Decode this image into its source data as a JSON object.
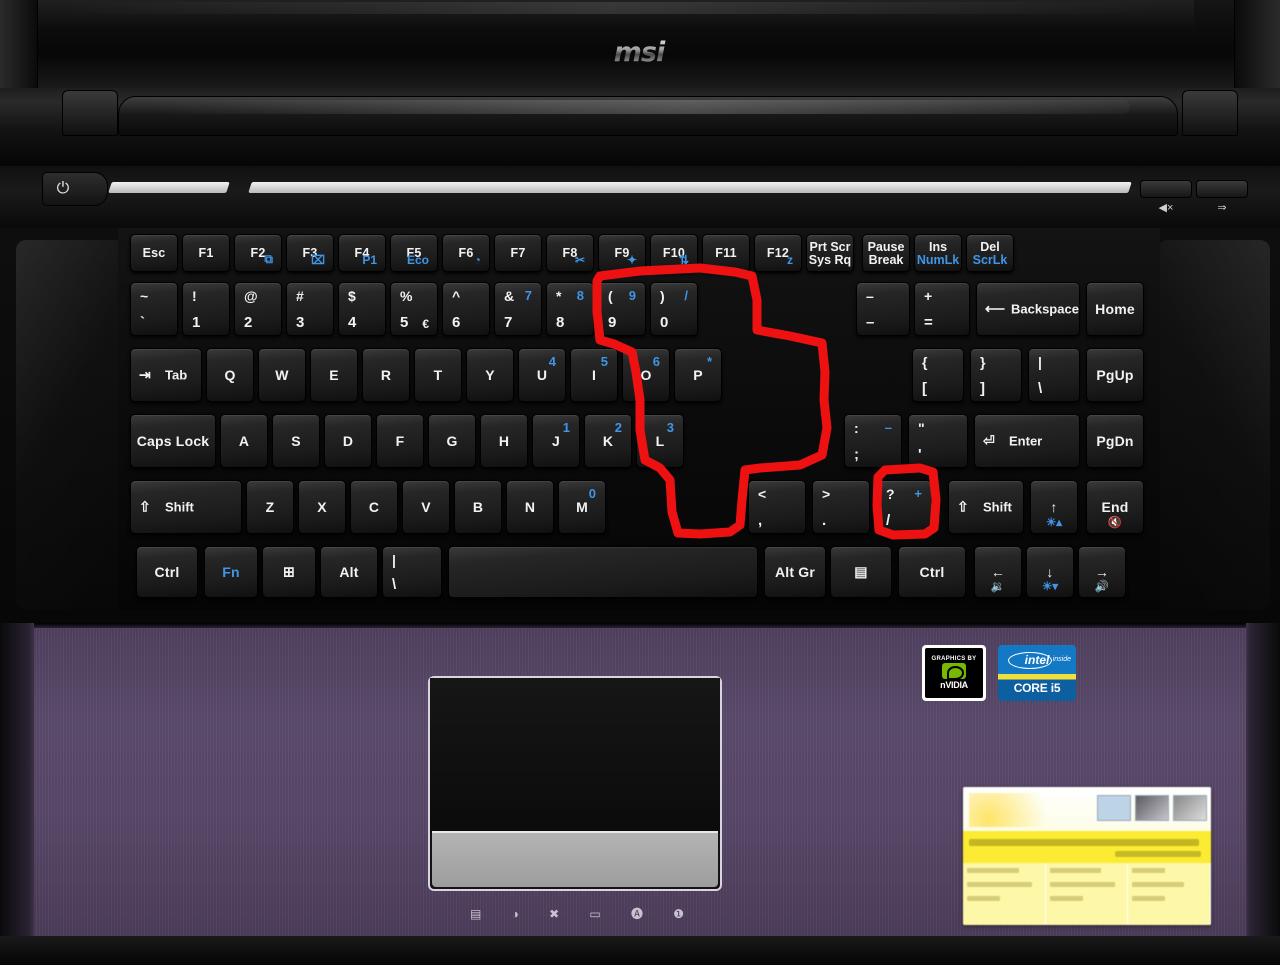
{
  "device": {
    "brand": "msi",
    "form": "laptop",
    "palm_rest_color": "#574669",
    "annotation_color": "#ee1111"
  },
  "lid": {
    "logo_text": "msi"
  },
  "top_deck": {
    "power_button_glyph": "⏻",
    "hotkeys": [
      {
        "name": "audio-mute-hotkey",
        "glyph": "◀×"
      },
      {
        "name": "turbo-boost-hotkey",
        "glyph": "⇒"
      }
    ]
  },
  "keyboard": {
    "rows": [
      {
        "name": "function-row",
        "keys": [
          {
            "name": "esc",
            "main": "Esc"
          },
          {
            "name": "f1",
            "main": "F1"
          },
          {
            "name": "f2",
            "main": "F2",
            "alt": "⧉",
            "alt_color": "#3f95e6"
          },
          {
            "name": "f3",
            "main": "F3",
            "alt": "⌧",
            "alt_color": "#3f95e6"
          },
          {
            "name": "f4",
            "main": "F4",
            "alt": "P1",
            "alt_color": "#3f95e6"
          },
          {
            "name": "f5",
            "main": "F5",
            "alt": "Eco",
            "alt_color": "#3f95e6"
          },
          {
            "name": "f6",
            "main": "F6",
            "alt": "◔",
            "alt_color": "#3f95e6"
          },
          {
            "name": "f7",
            "main": "F7"
          },
          {
            "name": "f8",
            "main": "F8",
            "alt": "✂",
            "alt_color": "#3f95e6"
          },
          {
            "name": "f9",
            "main": "F9",
            "alt": "✦",
            "alt_color": "#3f95e6"
          },
          {
            "name": "f10",
            "main": "F10",
            "alt": "⇅",
            "alt_color": "#3f95e6"
          },
          {
            "name": "f11",
            "main": "F11"
          },
          {
            "name": "f12",
            "main": "F12",
            "alt": "z",
            "alt_color": "#3f95e6"
          },
          {
            "name": "prt-scr",
            "top": "Prt Scr",
            "bottom": "Sys Rq"
          },
          {
            "name": "pause",
            "top": "Pause",
            "bottom": "Break"
          },
          {
            "name": "insert",
            "top": "Ins",
            "bottom": "NumLk",
            "bottom_color": "#3f95e6"
          },
          {
            "name": "delete",
            "top": "Del",
            "bottom": "ScrLk",
            "bottom_color": "#3f95e6"
          }
        ]
      },
      {
        "name": "number-row",
        "keys": [
          {
            "name": "tilde",
            "tl": "~",
            "bl": "`"
          },
          {
            "name": "digit-1",
            "tl": "!",
            "bl": "1"
          },
          {
            "name": "digit-2",
            "tl": "@",
            "bl": "2"
          },
          {
            "name": "digit-3",
            "tl": "#",
            "bl": "3"
          },
          {
            "name": "digit-4",
            "tl": "$",
            "bl": "4"
          },
          {
            "name": "digit-5",
            "tl": "%",
            "bl": "5",
            "br2": "€"
          },
          {
            "name": "digit-6",
            "tl": "^",
            "bl": "6"
          },
          {
            "name": "digit-7",
            "tl": "&",
            "bl": "7",
            "numpad": "7"
          },
          {
            "name": "digit-8",
            "tl": "*",
            "bl": "8",
            "numpad": "8"
          },
          {
            "name": "digit-9",
            "tl": "(",
            "bl": "9",
            "numpad": "9"
          },
          {
            "name": "digit-0",
            "tl": ")",
            "bl": "0",
            "numpad": "/"
          },
          {
            "name": "minus",
            "tl": "–",
            "bl": "–"
          },
          {
            "name": "equals",
            "tl": "+",
            "bl": "="
          },
          {
            "name": "backspace",
            "main": "Backspace",
            "glyph": "⟵"
          },
          {
            "name": "home",
            "main": "Home"
          }
        ]
      },
      {
        "name": "qwerty-row",
        "keys": [
          {
            "name": "tab",
            "main": "Tab",
            "glyph": "⇥"
          },
          {
            "name": "key-q",
            "main": "Q"
          },
          {
            "name": "key-w",
            "main": "W"
          },
          {
            "name": "key-e",
            "main": "E"
          },
          {
            "name": "key-r",
            "main": "R"
          },
          {
            "name": "key-t",
            "main": "T"
          },
          {
            "name": "key-y",
            "main": "Y"
          },
          {
            "name": "key-u",
            "main": "U",
            "numpad": "4"
          },
          {
            "name": "key-i",
            "main": "I",
            "numpad": "5"
          },
          {
            "name": "key-o",
            "main": "O",
            "numpad": "6"
          },
          {
            "name": "key-p",
            "main": "P",
            "numpad": "*"
          },
          {
            "name": "bracket-left",
            "tl": "{",
            "bl": "["
          },
          {
            "name": "bracket-right",
            "tl": "}",
            "bl": "]"
          },
          {
            "name": "backslash",
            "tl": "|",
            "bl": "\\"
          },
          {
            "name": "page-up",
            "main": "PgUp"
          }
        ]
      },
      {
        "name": "home-row",
        "keys": [
          {
            "name": "caps-lock",
            "main": "Caps Lock"
          },
          {
            "name": "key-a",
            "main": "A"
          },
          {
            "name": "key-s",
            "main": "S"
          },
          {
            "name": "key-d",
            "main": "D"
          },
          {
            "name": "key-f",
            "main": "F"
          },
          {
            "name": "key-g",
            "main": "G"
          },
          {
            "name": "key-h",
            "main": "H"
          },
          {
            "name": "key-j",
            "main": "J",
            "numpad": "1"
          },
          {
            "name": "key-k",
            "main": "K",
            "numpad": "2"
          },
          {
            "name": "key-l",
            "main": "L",
            "numpad": "3"
          },
          {
            "name": "semicolon",
            "tl": ":",
            "bl": ";",
            "numpad": "–"
          },
          {
            "name": "quote",
            "tl": "\"",
            "bl": "'"
          },
          {
            "name": "enter",
            "main": "Enter",
            "glyph": "⏎"
          },
          {
            "name": "page-down",
            "main": "PgDn"
          }
        ]
      },
      {
        "name": "shift-row",
        "keys": [
          {
            "name": "shift-left",
            "main": "Shift",
            "glyph": "⇧"
          },
          {
            "name": "key-z",
            "main": "Z"
          },
          {
            "name": "key-x",
            "main": "X"
          },
          {
            "name": "key-c",
            "main": "C"
          },
          {
            "name": "key-v",
            "main": "V"
          },
          {
            "name": "key-b",
            "main": "B"
          },
          {
            "name": "key-n",
            "main": "N"
          },
          {
            "name": "key-m",
            "main": "M",
            "numpad": "0"
          },
          {
            "name": "comma",
            "tl": "<",
            "bl": ","
          },
          {
            "name": "period",
            "tl": ">",
            "bl": "."
          },
          {
            "name": "slash",
            "tl": "?",
            "bl": "/",
            "numpad": "+"
          },
          {
            "name": "shift-right",
            "main": "Shift",
            "glyph": "⇧"
          },
          {
            "name": "arrow-up",
            "glyph": "↑",
            "sub": "☀▴"
          },
          {
            "name": "end",
            "main": "End",
            "sub": "🔇"
          }
        ]
      },
      {
        "name": "bottom-row",
        "keys": [
          {
            "name": "ctrl-left",
            "main": "Ctrl"
          },
          {
            "name": "fn",
            "main": "Fn",
            "color": "#3f95e6"
          },
          {
            "name": "windows",
            "glyph": "⊞"
          },
          {
            "name": "alt-left",
            "main": "Alt"
          },
          {
            "name": "pipe-backslash",
            "tl": "|",
            "bl": "\\"
          },
          {
            "name": "space",
            "main": ""
          },
          {
            "name": "alt-gr",
            "main": "Alt Gr"
          },
          {
            "name": "menu",
            "glyph": "▤"
          },
          {
            "name": "ctrl-right",
            "main": "Ctrl"
          },
          {
            "name": "arrow-left",
            "glyph": "←",
            "sub": "🔉"
          },
          {
            "name": "arrow-down",
            "glyph": "↓",
            "sub": "☀▾"
          },
          {
            "name": "arrow-right",
            "glyph": "→",
            "sub": "🔊"
          }
        ]
      }
    ]
  },
  "annotation": {
    "description": "Red hand-drawn outline highlighting the embedded numeric keypad keys",
    "enclosed_keys": [
      "7",
      "8",
      "9",
      "U",
      "I",
      "O",
      "J",
      "K",
      "L",
      "M"
    ],
    "second_box_keys": [
      "?/"
    ],
    "color": "#ee1111",
    "stroke_width": 9
  },
  "palm_rest": {
    "touchpad_name": "touchpad",
    "indicators": [
      {
        "name": "hdd-indicator",
        "glyph": "▤"
      },
      {
        "name": "power-indicator",
        "glyph": "◑"
      },
      {
        "name": "bluetooth-indicator",
        "glyph": "✖"
      },
      {
        "name": "battery-indicator",
        "glyph": "▭"
      },
      {
        "name": "caps-lock-indicator",
        "glyph": "🅐"
      },
      {
        "name": "num-lock-indicator",
        "glyph": "❶"
      }
    ]
  },
  "stickers": [
    {
      "name": "nvidia-sticker",
      "line1": "GRAPHICS BY",
      "line2": "nVIDIA",
      "color": "#76b900"
    },
    {
      "name": "intel-core-i5-sticker",
      "line1": "intel",
      "line2": "inside",
      "line3": "CORE i5",
      "color": "#1479c4"
    },
    {
      "name": "retail-warranty-sticker",
      "note": "yellow-and-white retail label, text illegible"
    }
  ]
}
